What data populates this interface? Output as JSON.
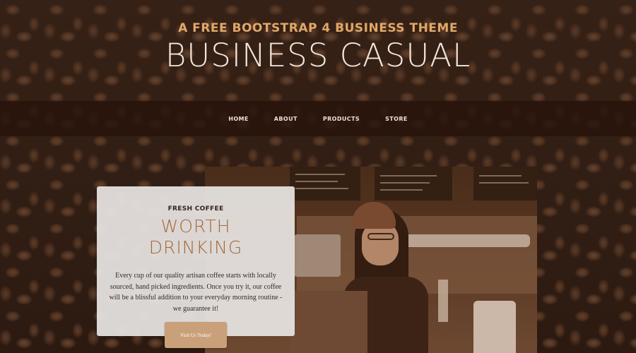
{
  "header": {
    "subtitle": "A FREE BOOTSTRAP 4 BUSINESS THEME",
    "title": "BUSINESS CASUAL"
  },
  "nav": {
    "items": [
      {
        "label": "HOME"
      },
      {
        "label": "ABOUT"
      },
      {
        "label": "PRODUCTS"
      },
      {
        "label": "STORE"
      }
    ]
  },
  "intro": {
    "eyebrow": "FRESH COFFEE",
    "heading_line1": "WORTH",
    "heading_line2": "DRINKING",
    "body": "Every cup of our quality artisan coffee starts with locally sourced, hand picked ingredients. Once you try it, our coffee will be a blissful addition to your everyday morning routine - we guarantee it!",
    "cta_label": "Visit Us Today!"
  },
  "colors": {
    "accent": "#e0a868",
    "heading_light": "#f3e6d9",
    "nav_bg": "#28140c",
    "card_bg": "#e6e2e0",
    "card_heading": "#a56a3a",
    "button_bg": "#c9a07a"
  }
}
